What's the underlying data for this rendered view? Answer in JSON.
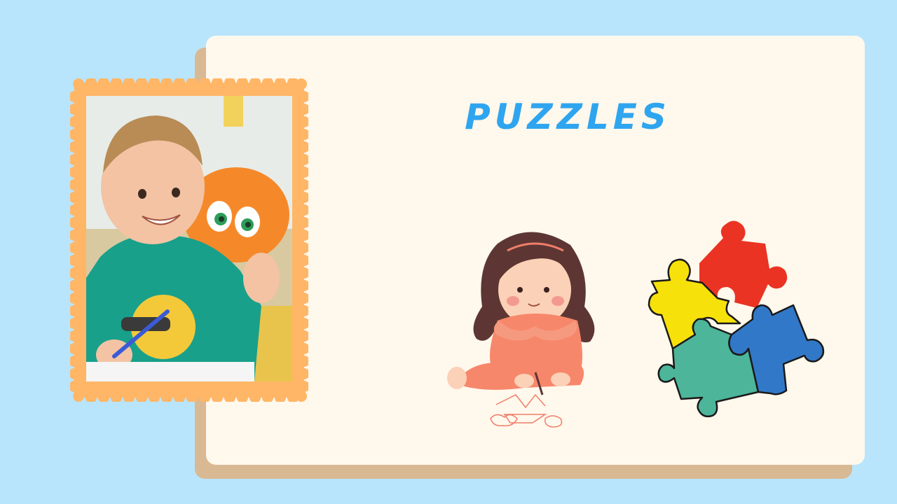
{
  "slide": {
    "title": "PUZZLES"
  },
  "colors": {
    "background": "#b9e5fc",
    "card": "#fff8ec",
    "card_shadow": "#d8b993",
    "frame": "#ffb667",
    "title": "#2fa5ef",
    "puzzle_red": "#ea3323",
    "puzzle_yellow": "#f7e10a",
    "puzzle_green": "#4cb59a",
    "puzzle_blue": "#3278c8"
  },
  "images": {
    "photo": "child-drawing-photo",
    "girl": "girl-drawing-illustration",
    "puzzle": "puzzle-pieces-illustration"
  }
}
